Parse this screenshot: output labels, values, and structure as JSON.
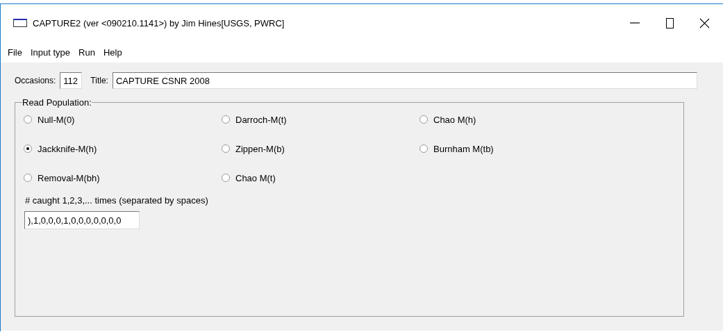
{
  "window": {
    "title": "CAPTURE2  (ver <090210.1141>) by Jim Hines[USGS, PWRC]"
  },
  "menu": [
    "File",
    "Input type",
    "Run",
    "Help"
  ],
  "occasions": {
    "label": "Occasions:",
    "value": "112"
  },
  "title_field": {
    "label": "Title:",
    "value": "CAPTURE CSNR 2008"
  },
  "group": {
    "label": "Read Population:",
    "options": [
      {
        "label": "Null-M(0)",
        "selected": false
      },
      {
        "label": "Jackknife-M(h)",
        "selected": true
      },
      {
        "label": "Removal-M(bh)",
        "selected": false
      },
      {
        "label": "Darroch-M(t)",
        "selected": false
      },
      {
        "label": "Zippen-M(b)",
        "selected": false
      },
      {
        "label": "Chao M(t)",
        "selected": false
      },
      {
        "label": "Chao M(h)",
        "selected": false
      },
      {
        "label": "Burnham M(tb)",
        "selected": false
      }
    ],
    "caught_label": "# caught 1,2,3,... times (separated by spaces)",
    "caught_value": "),1,0,0,0,1,0,0,0,0,0,0,0"
  }
}
